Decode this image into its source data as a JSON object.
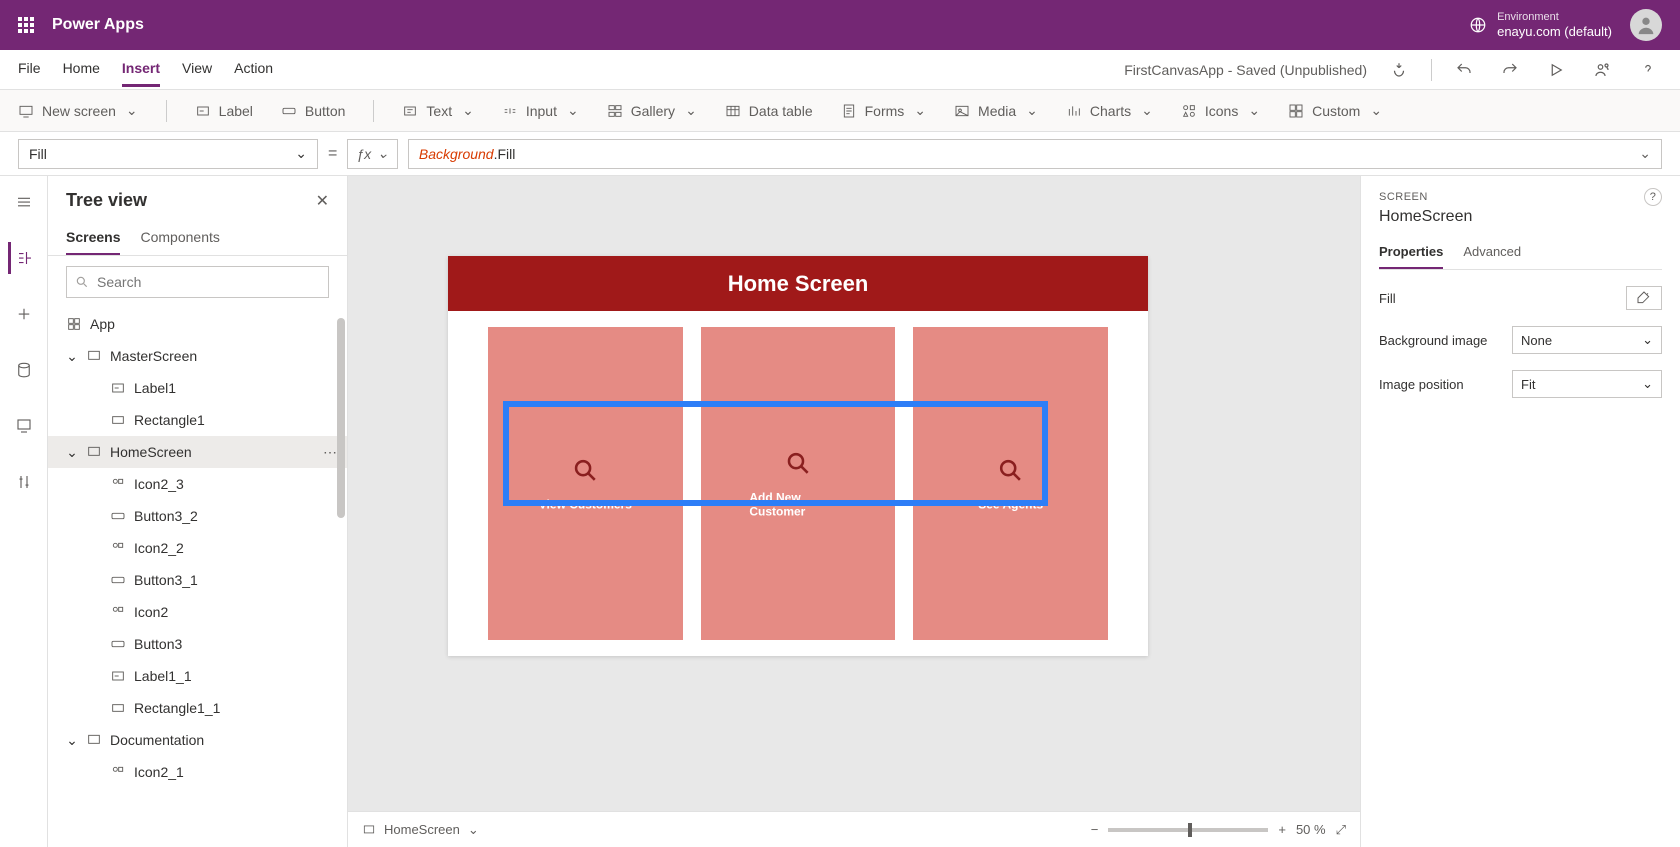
{
  "header": {
    "app_name": "Power Apps",
    "env_label": "Environment",
    "env_value": "enayu.com (default)"
  },
  "menubar": {
    "items": [
      "File",
      "Home",
      "Insert",
      "View",
      "Action"
    ],
    "active": "Insert",
    "status": "FirstCanvasApp - Saved (Unpublished)"
  },
  "commandbar": {
    "new_screen": "New screen",
    "label": "Label",
    "button": "Button",
    "text": "Text",
    "input": "Input",
    "gallery": "Gallery",
    "data_table": "Data table",
    "forms": "Forms",
    "media": "Media",
    "charts": "Charts",
    "icons": "Icons",
    "custom": "Custom"
  },
  "formula": {
    "property": "Fill",
    "expression_parts": {
      "object": "Background",
      "prop": ".Fill"
    }
  },
  "tree": {
    "title": "Tree view",
    "tabs": {
      "screens": "Screens",
      "components": "Components"
    },
    "search_placeholder": "Search",
    "nodes": {
      "app": "App",
      "master": "MasterScreen",
      "master_children": [
        "Label1",
        "Rectangle1"
      ],
      "home": "HomeScreen",
      "home_children": [
        "Icon2_3",
        "Button3_2",
        "Icon2_2",
        "Button3_1",
        "Icon2",
        "Button3",
        "Label1_1",
        "Rectangle1_1"
      ],
      "doc": "Documentation",
      "doc_children": [
        "Icon2_1"
      ]
    }
  },
  "canvas": {
    "header": "Home Screen",
    "cards": [
      "View Customers",
      "Add New Customer",
      "See Agents"
    ],
    "breadcrumb": "HomeScreen",
    "zoom_label": "50 %"
  },
  "props": {
    "kicker": "SCREEN",
    "title": "HomeScreen",
    "tabs": {
      "properties": "Properties",
      "advanced": "Advanced"
    },
    "fill_label": "Fill",
    "bg_image_label": "Background image",
    "bg_image_value": "None",
    "image_pos_label": "Image position",
    "image_pos_value": "Fit"
  },
  "colors": {
    "brand": "#742774",
    "canvas_header": "#a01919",
    "card": "#e58b84",
    "selection": "#2d7ef7"
  }
}
